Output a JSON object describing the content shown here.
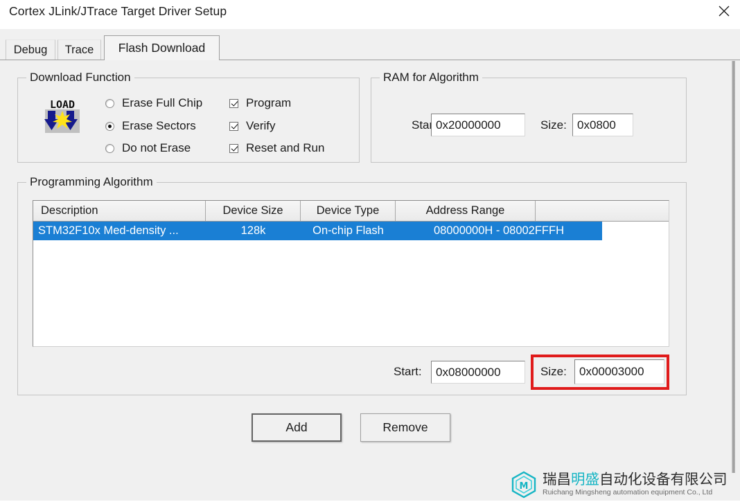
{
  "window": {
    "title": "Cortex JLink/JTrace Target Driver Setup",
    "close_label": "✕"
  },
  "tabs": [
    {
      "label": "Debug",
      "active": false
    },
    {
      "label": "Trace",
      "active": false
    },
    {
      "label": "Flash Download",
      "active": true
    }
  ],
  "download_function": {
    "title": "Download Function",
    "icon": "load-icon",
    "radios": [
      {
        "label": "Erase Full Chip",
        "checked": false
      },
      {
        "label": "Erase Sectors",
        "checked": true
      },
      {
        "label": "Do not Erase",
        "checked": false
      }
    ],
    "checkboxes": [
      {
        "label": "Program",
        "checked": true
      },
      {
        "label": "Verify",
        "checked": true
      },
      {
        "label": "Reset and Run",
        "checked": true
      }
    ]
  },
  "ram_for_algorithm": {
    "title": "RAM for Algorithm",
    "start_label": "Start:",
    "start_value": "0x20000000",
    "size_label": "Size:",
    "size_value": "0x0800"
  },
  "programming_algorithm": {
    "title": "Programming Algorithm",
    "columns": [
      "Description",
      "Device Size",
      "Device Type",
      "Address Range",
      ""
    ],
    "rows": [
      {
        "description": "STM32F10x Med-density ...",
        "device_size": "128k",
        "device_type": "On-chip Flash",
        "address_range": "08000000H - 08002FFFH",
        "selected": true
      }
    ],
    "start_label": "Start:",
    "start_value": "0x08000000",
    "size_label": "Size:",
    "size_value": "0x00003000",
    "highlight_color": "#e01b1b",
    "selection_color": "#1a7fd4"
  },
  "buttons": {
    "add": "Add",
    "remove": "Remove"
  },
  "watermark": {
    "cn_part1": "瑞昌",
    "cn_highlight": "明盛",
    "cn_part2": "自动化设备有限公司",
    "en": "Ruichang Mingsheng automation equipment Co., Ltd",
    "accent_color": "#16b5c4"
  }
}
